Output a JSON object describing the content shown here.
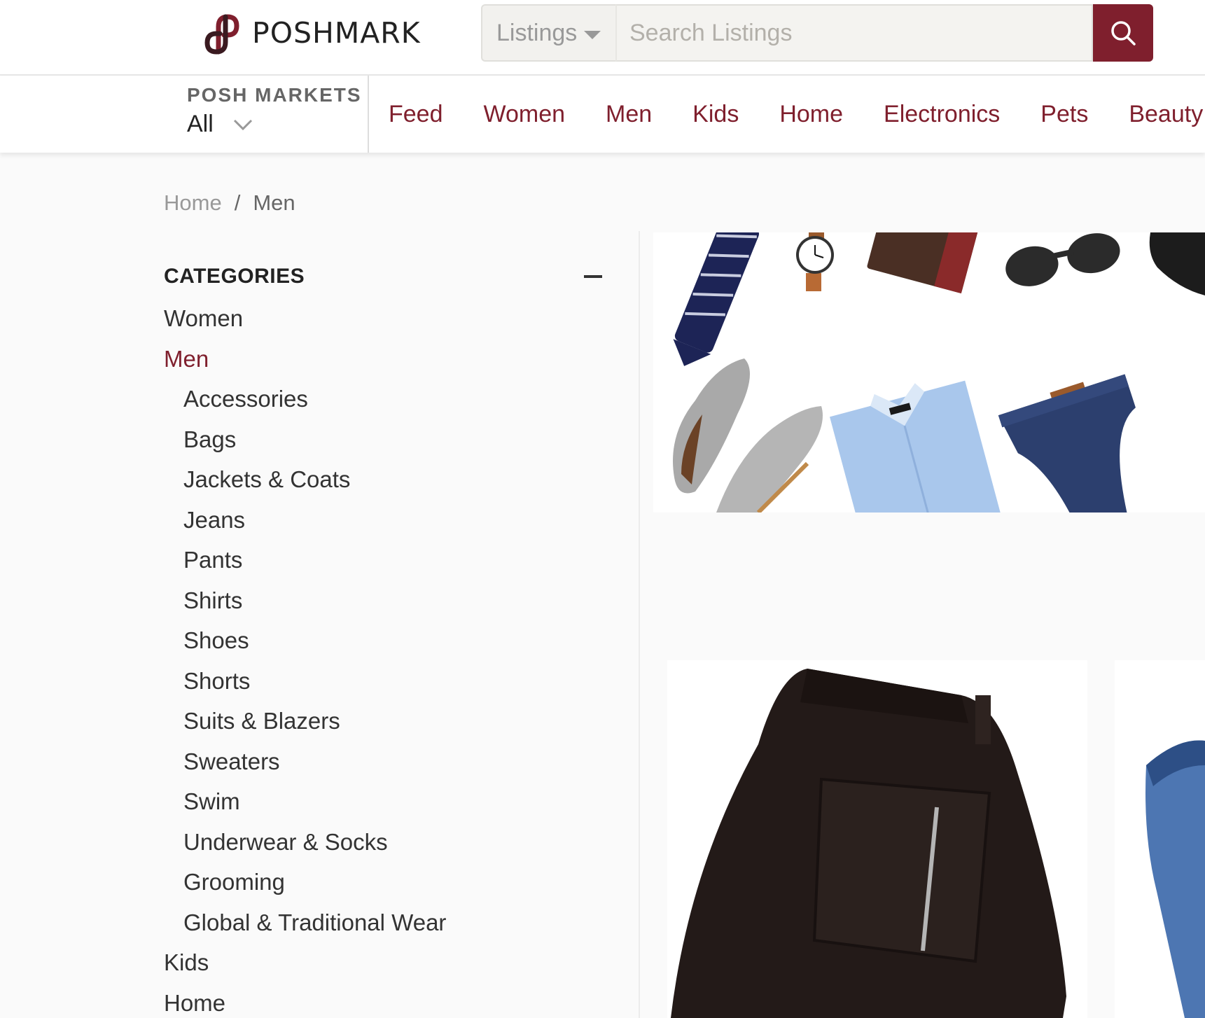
{
  "brand": {
    "name": "POSHMARK",
    "accent": "#7f1f2d"
  },
  "search": {
    "scope": "Listings",
    "placeholder": "Search Listings",
    "button_icon": "search-icon"
  },
  "posh_markets": {
    "title": "POSH MARKETS",
    "value": "All"
  },
  "nav": {
    "items": [
      "Feed",
      "Women",
      "Men",
      "Kids",
      "Home",
      "Electronics",
      "Pets",
      "Beauty"
    ]
  },
  "breadcrumb": {
    "home": "Home",
    "separator": "/",
    "current": "Men"
  },
  "sidebar": {
    "title": "CATEGORIES",
    "items": [
      {
        "label": "Women"
      },
      {
        "label": "Men",
        "active": true
      },
      {
        "label": "Accessories",
        "sub": true
      },
      {
        "label": "Bags",
        "sub": true
      },
      {
        "label": "Jackets & Coats",
        "sub": true
      },
      {
        "label": "Jeans",
        "sub": true
      },
      {
        "label": "Pants",
        "sub": true
      },
      {
        "label": "Shirts",
        "sub": true
      },
      {
        "label": "Shoes",
        "sub": true
      },
      {
        "label": "Shorts",
        "sub": true
      },
      {
        "label": "Suits & Blazers",
        "sub": true
      },
      {
        "label": "Sweaters",
        "sub": true
      },
      {
        "label": "Swim",
        "sub": true
      },
      {
        "label": "Underwear & Socks",
        "sub": true
      },
      {
        "label": "Grooming",
        "sub": true
      },
      {
        "label": "Global & Traditional Wear",
        "sub": true
      },
      {
        "label": "Kids"
      },
      {
        "label": "Home"
      }
    ]
  }
}
